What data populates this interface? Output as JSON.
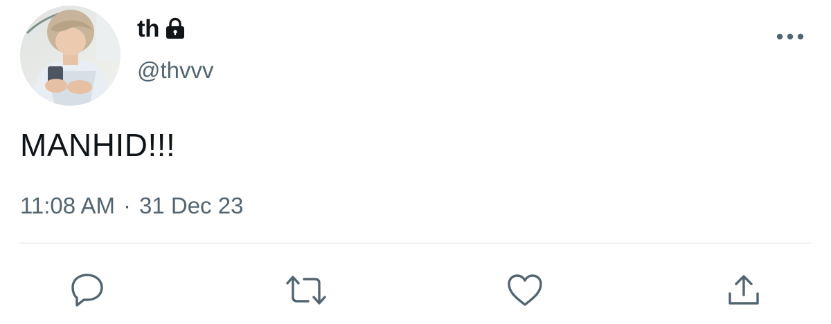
{
  "author": {
    "display_name": "th",
    "handle": "@thvvv",
    "protected": true
  },
  "tweet": {
    "text": "MANHID!!!",
    "time": "11:08 AM",
    "separator": "·",
    "date": "31 Dec 23"
  },
  "icons": {
    "lock": "lock-icon",
    "more": "more-icon",
    "reply": "reply-icon",
    "retweet": "retweet-icon",
    "like": "heart-icon",
    "share": "share-icon"
  },
  "colors": {
    "text_primary": "#0f1419",
    "text_secondary": "#536471",
    "divider": "#eff3f4"
  }
}
